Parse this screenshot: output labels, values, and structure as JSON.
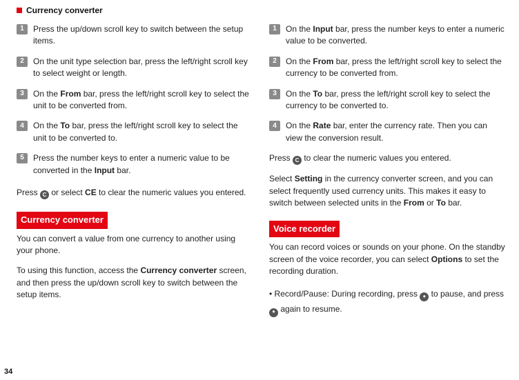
{
  "header": {
    "title": "Currency converter"
  },
  "left": {
    "steps": [
      {
        "n": "1",
        "text": "Press the up/down scroll key to switch between the setup items."
      },
      {
        "n": "2",
        "text": "On the unit type selection bar, press the left/right scroll key to select weight or length."
      },
      {
        "n": "3",
        "pre": "On the ",
        "b1": "From",
        "post": " bar, press the left/right scroll key to select the unit to be converted from."
      },
      {
        "n": "4",
        "pre": "On the ",
        "b1": "To",
        "post": " bar, press the left/right scroll key to select the unit to be converted to."
      },
      {
        "n": "5",
        "pre": "Press the number keys to enter a numeric value to be converted in the ",
        "b1": "Input",
        "post": " bar."
      }
    ],
    "clear_pre": "Press ",
    "clear_icon": "C",
    "clear_mid": " or select ",
    "clear_bold": "CE",
    "clear_post": " to clear the numeric values you entered.",
    "sect_head": "Currency converter",
    "sect_p1": "You can convert a value from one currency to another using your phone.",
    "sect_p2_pre": "To using this function, access the ",
    "sect_p2_bold": "Currency con­verter",
    "sect_p2_post": " screen, and then press the up/down scroll key to switch between the setup items."
  },
  "right": {
    "steps": [
      {
        "n": "1",
        "pre": "On the ",
        "b1": "Input",
        "post": " bar, press the number keys to enter a numeric value to be converted."
      },
      {
        "n": "2",
        "pre": "On the ",
        "b1": "From",
        "post": " bar, press the left/right scroll key to select the currency to be converted from."
      },
      {
        "n": "3",
        "pre": "On the ",
        "b1": "To",
        "post": " bar, press the left/right scroll key to select the currency to be converted to."
      },
      {
        "n": "4",
        "pre": "On the ",
        "b1": "Rate",
        "post": " bar, enter the currency rate. Then you can view the conversion result."
      }
    ],
    "clear_pre": "Press ",
    "clear_icon": "C",
    "clear_post": " to clear the numeric values you entered.",
    "setting_pre": "Select ",
    "setting_b1": "Setting",
    "setting_mid": " in the currency converter screen, and you can select frequently used currency units. This makes it easy to switch between selected units in the ",
    "setting_b2": "From",
    "setting_mid2": " or ",
    "setting_b3": "To",
    "setting_post": " bar.",
    "vr_head": "Voice recorder",
    "vr_p1": "You can record voices or sounds on your phone. On the standby screen of the voice recorder, you can select ",
    "vr_p1_b": "Options",
    "vr_p1_post": " to set the recording duration.",
    "bullet_pre": "• Record/Pause:  During recording, press ",
    "bullet_icon1": "⏺",
    "bullet_mid": " to pause, and press ",
    "bullet_icon2": "⏺",
    "bullet_post": " again to resume."
  },
  "page_number": "34"
}
